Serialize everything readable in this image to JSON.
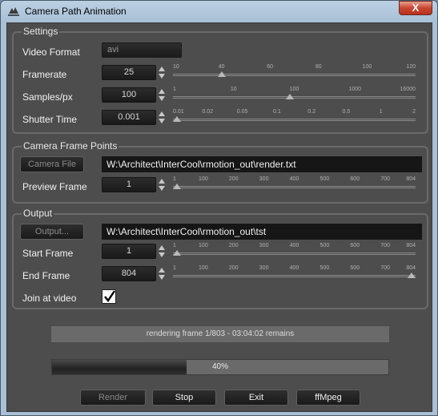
{
  "window": {
    "title": "Camera Path Animation",
    "close_glyph": "X"
  },
  "settings": {
    "title": "Settings",
    "video_format": {
      "label": "Video Format",
      "value": "avi"
    },
    "framerate": {
      "label": "Framerate",
      "value": "25",
      "ticks": [
        "10",
        "40",
        "60",
        "80",
        "100",
        "120"
      ],
      "slider_fraction": 0.19
    },
    "samples": {
      "label": "Samples/px",
      "value": "100",
      "ticks": [
        "1",
        "10",
        "100",
        "1000",
        "16000"
      ],
      "slider_fraction": 0.48
    },
    "shutter": {
      "label": "Shutter Time",
      "value": "0.001",
      "ticks": [
        "0.01",
        "0.02",
        "0.05",
        "0.1",
        "0.2",
        "0.5",
        "1",
        "2"
      ],
      "slider_fraction": 0.0
    }
  },
  "camera_points": {
    "title": "Camera Frame Points",
    "button": "Camera File",
    "path": "W:\\Architect\\InterCool\\rmotion_out\\render.txt",
    "preview": {
      "label": "Preview Frame",
      "value": "1",
      "ticks": [
        "1",
        "100",
        "200",
        "300",
        "400",
        "500",
        "600",
        "700",
        "804"
      ],
      "slider_fraction": 0.0
    }
  },
  "output": {
    "title": "Output",
    "button": "Output...",
    "path": "W:\\Architect\\InterCool\\rmotion_out\\tst",
    "start": {
      "label": "Start Frame",
      "value": "1",
      "ticks": [
        "1",
        "100",
        "200",
        "300",
        "400",
        "500",
        "600",
        "700",
        "804"
      ],
      "slider_fraction": 0.0
    },
    "end": {
      "label": "End Frame",
      "value": "804",
      "ticks": [
        "1",
        "100",
        "200",
        "300",
        "400",
        "500",
        "600",
        "700",
        "804"
      ],
      "slider_fraction": 1.0
    },
    "join": {
      "label": "Join at video",
      "checked": true
    }
  },
  "status_text": "rendering frame 1/803 - 03:04:02 remains",
  "progress": {
    "label": "40%",
    "fraction": 0.4
  },
  "buttons": {
    "render": "Render",
    "stop": "Stop",
    "exit": "Exit",
    "ffmpeg": "ffMpeg"
  }
}
